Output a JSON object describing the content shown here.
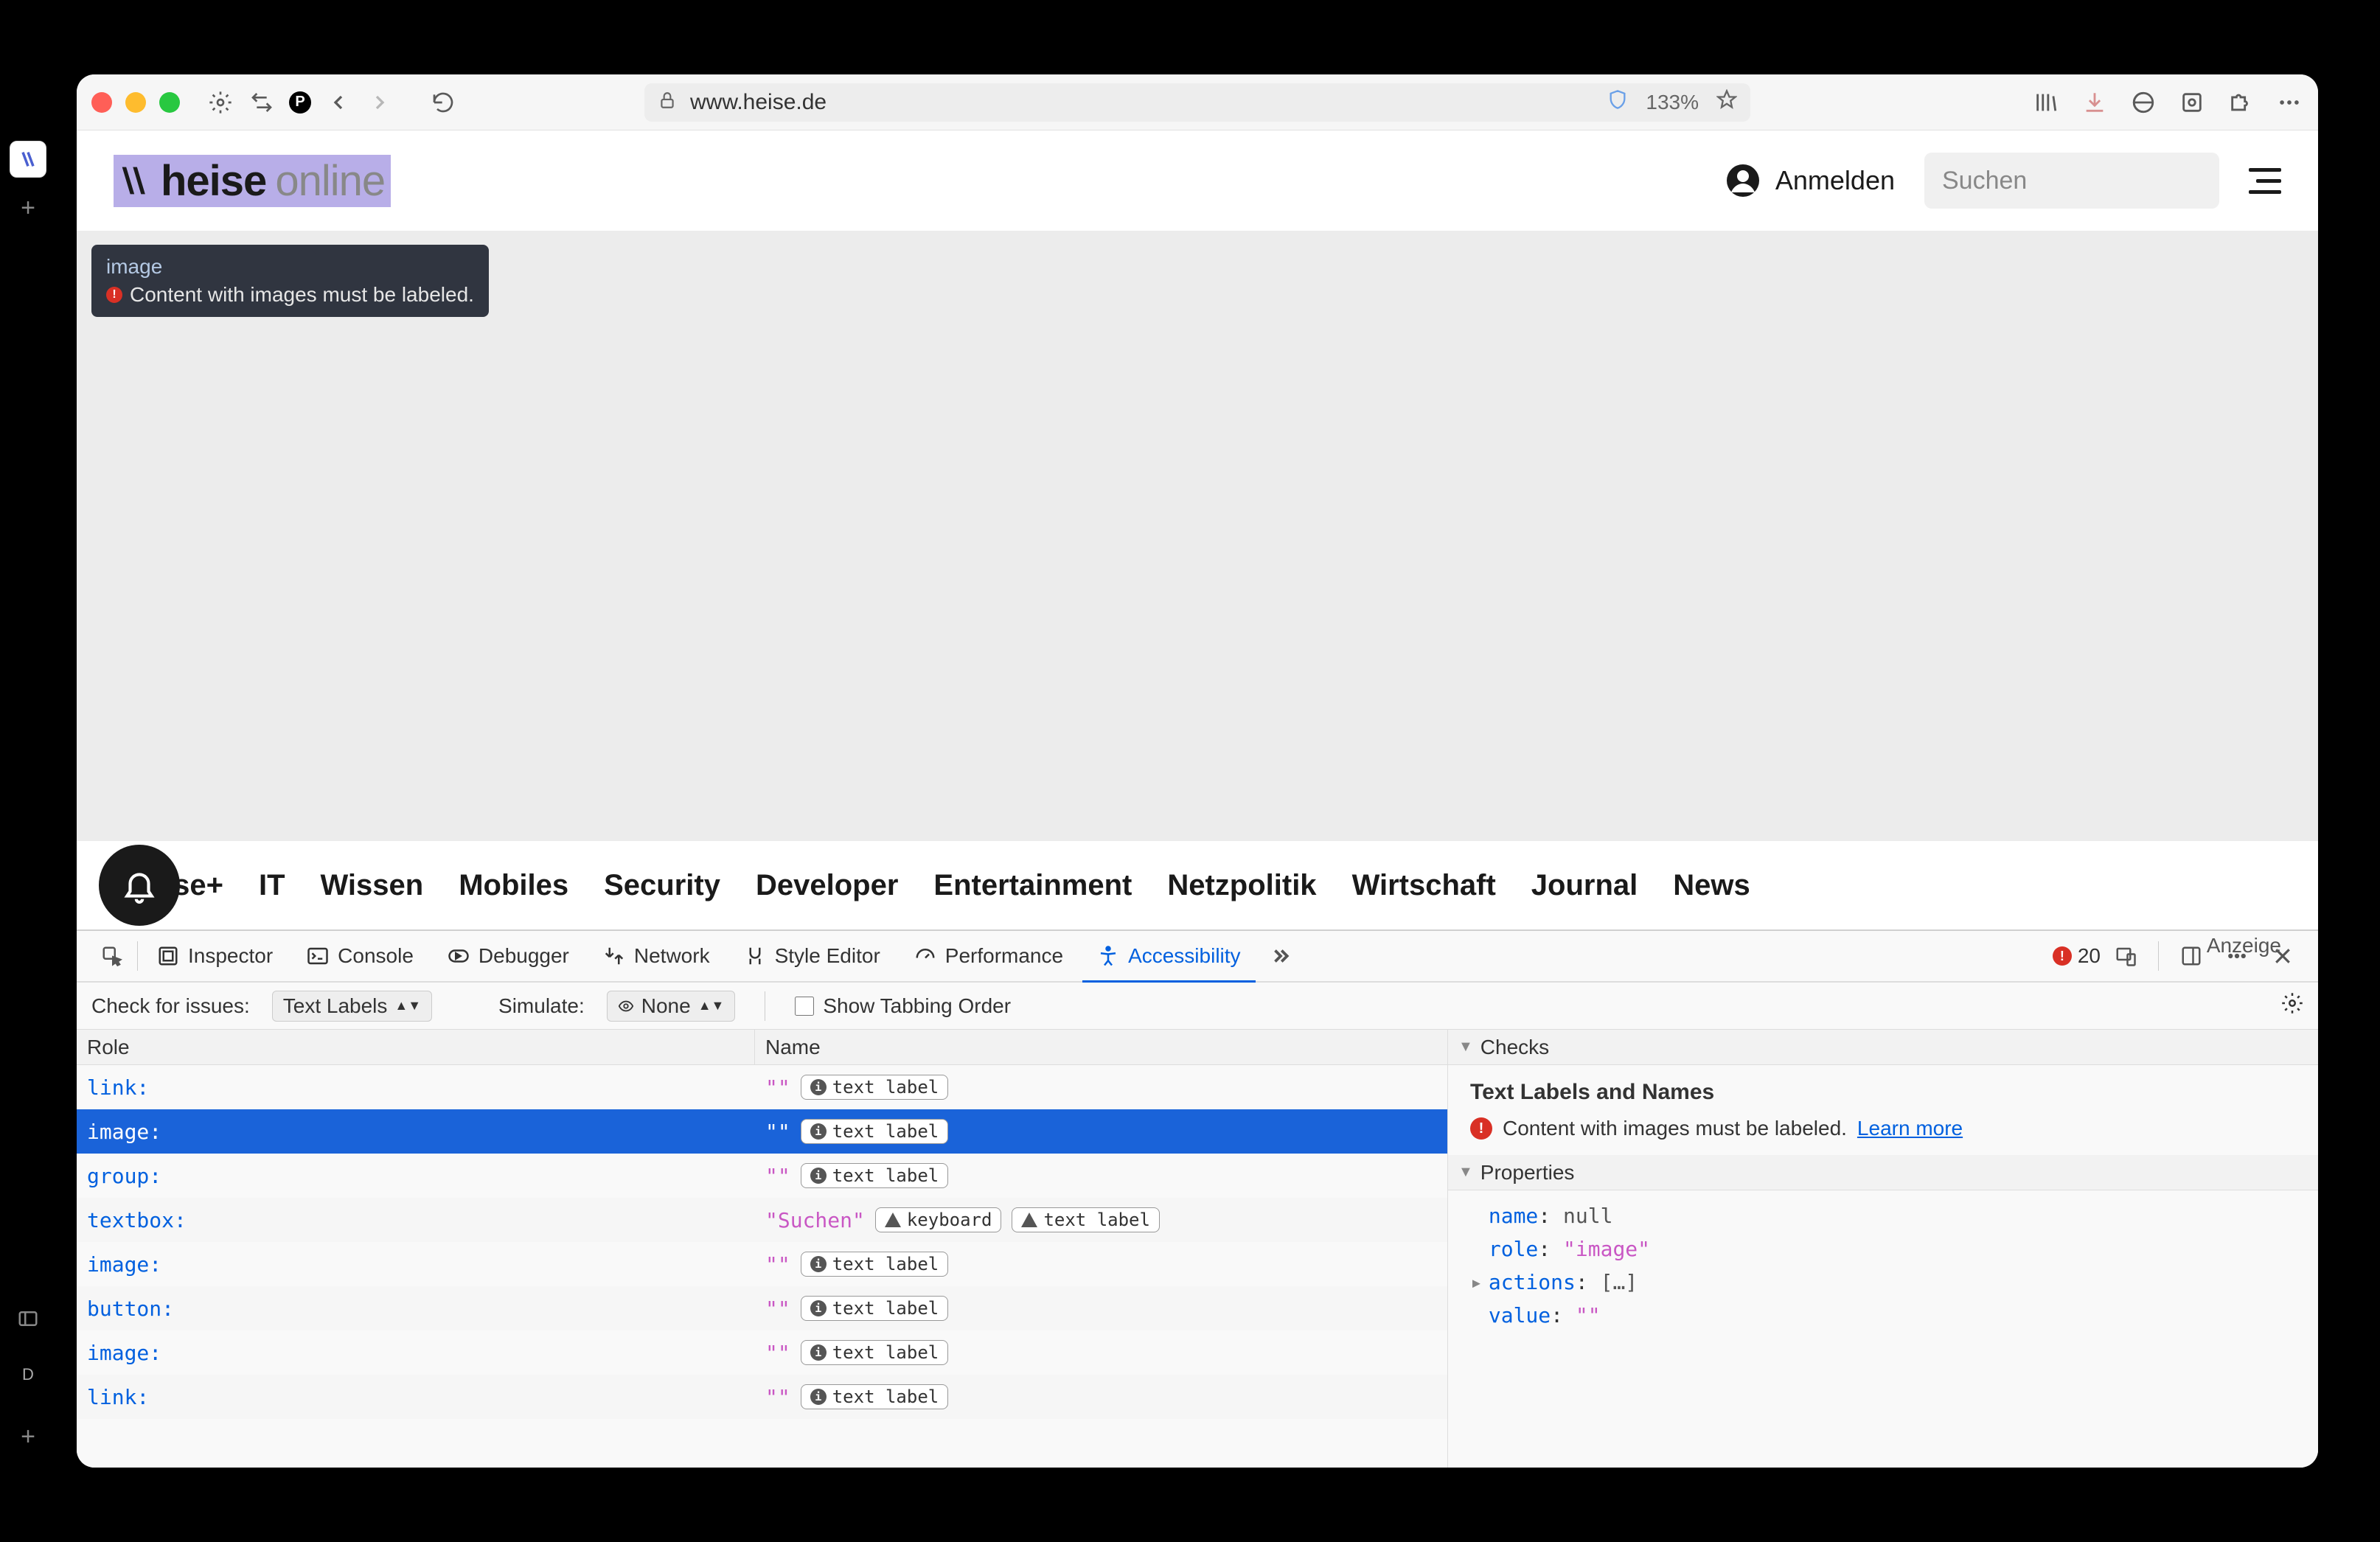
{
  "browser": {
    "url": "www.heise.de",
    "zoom": "133%",
    "traffic": [
      "close",
      "minimize",
      "maximize"
    ]
  },
  "site": {
    "logo_main": "heise",
    "logo_sub": "online",
    "tooltip_role": "image",
    "tooltip_msg": "Content with images must be labeled.",
    "login_label": "Anmelden",
    "search_placeholder": "Suchen",
    "nav": [
      "ise+",
      "IT",
      "Wissen",
      "Mobiles",
      "Security",
      "Developer",
      "Entertainment",
      "Netzpolitik",
      "Wirtschaft",
      "Journal",
      "News"
    ],
    "anzeige": "Anzeige"
  },
  "devtools": {
    "tabs": {
      "inspector": "Inspector",
      "console": "Console",
      "debugger": "Debugger",
      "network": "Network",
      "style": "Style Editor",
      "perf": "Performance",
      "a11y": "Accessibility"
    },
    "err_count": "20",
    "toolbar": {
      "check_label": "Check for issues:",
      "check_value": "Text Labels",
      "simulate_label": "Simulate:",
      "simulate_value": "None",
      "tabbing": "Show Tabbing Order"
    },
    "cols": {
      "role": "Role",
      "name": "Name"
    },
    "rows": [
      {
        "role": "link:",
        "name": "\"\"",
        "badges": [
          "text label"
        ]
      },
      {
        "role": "image:",
        "name": "\"\"",
        "badges": [
          "text label"
        ],
        "selected": true
      },
      {
        "role": "group:",
        "name": "\"\"",
        "badges": [
          "text label"
        ]
      },
      {
        "role": "textbox:",
        "name": "\"Suchen\"",
        "badges": [
          "keyboard",
          "text label"
        ],
        "warn": true
      },
      {
        "role": "image:",
        "name": "\"\"",
        "badges": [
          "text label"
        ]
      },
      {
        "role": "button:",
        "name": "\"\"",
        "badges": [
          "text label"
        ]
      },
      {
        "role": "image:",
        "name": "\"\"",
        "badges": [
          "text label"
        ]
      },
      {
        "role": "link:",
        "name": "\"\"",
        "badges": [
          "text label"
        ]
      }
    ],
    "checks": {
      "header": "Checks",
      "title": "Text Labels and Names",
      "msg": "Content with images must be labeled.",
      "learn": "Learn more"
    },
    "props": {
      "header": "Properties",
      "items": [
        {
          "k": "name",
          "v": "null",
          "type": "plain"
        },
        {
          "k": "role",
          "v": "\"image\"",
          "type": "str"
        },
        {
          "k": "actions",
          "v": "[…]",
          "type": "plain",
          "expandable": true
        },
        {
          "k": "value",
          "v": "\"\"",
          "type": "str"
        }
      ]
    }
  }
}
